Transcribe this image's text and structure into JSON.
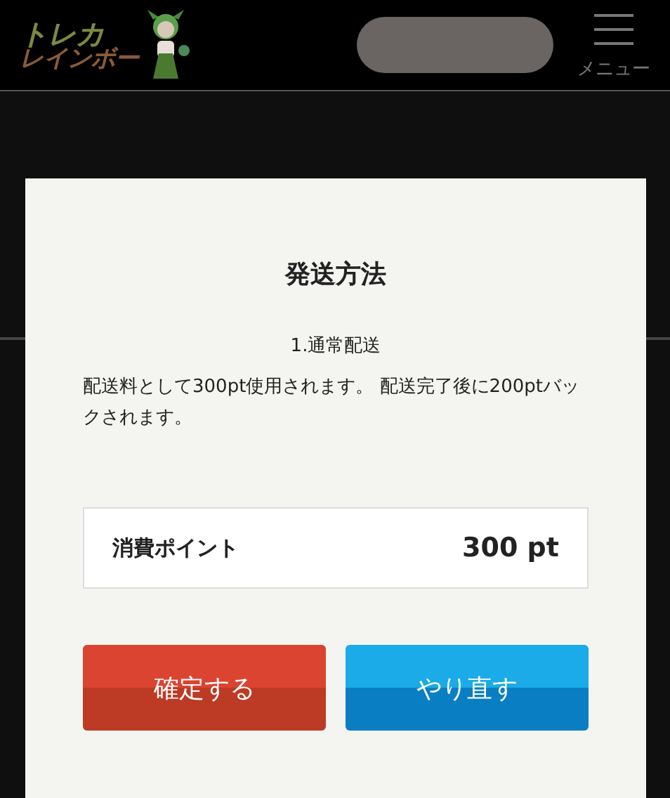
{
  "header": {
    "logo": {
      "line_1": "トレカ",
      "line_2": "レインボー"
    },
    "menu_label": "メニュー"
  },
  "dialog": {
    "title": "発送方法",
    "option": "1.通常配送",
    "description": "配送料として300pt使用されます。 配送完了後に200ptバックされます。",
    "points": {
      "label": "消費ポイント",
      "value": "300 pt"
    },
    "buttons": [
      {
        "label": "確定する",
        "kind": "confirm"
      },
      {
        "label": "やり直す",
        "kind": "retry"
      }
    ]
  }
}
